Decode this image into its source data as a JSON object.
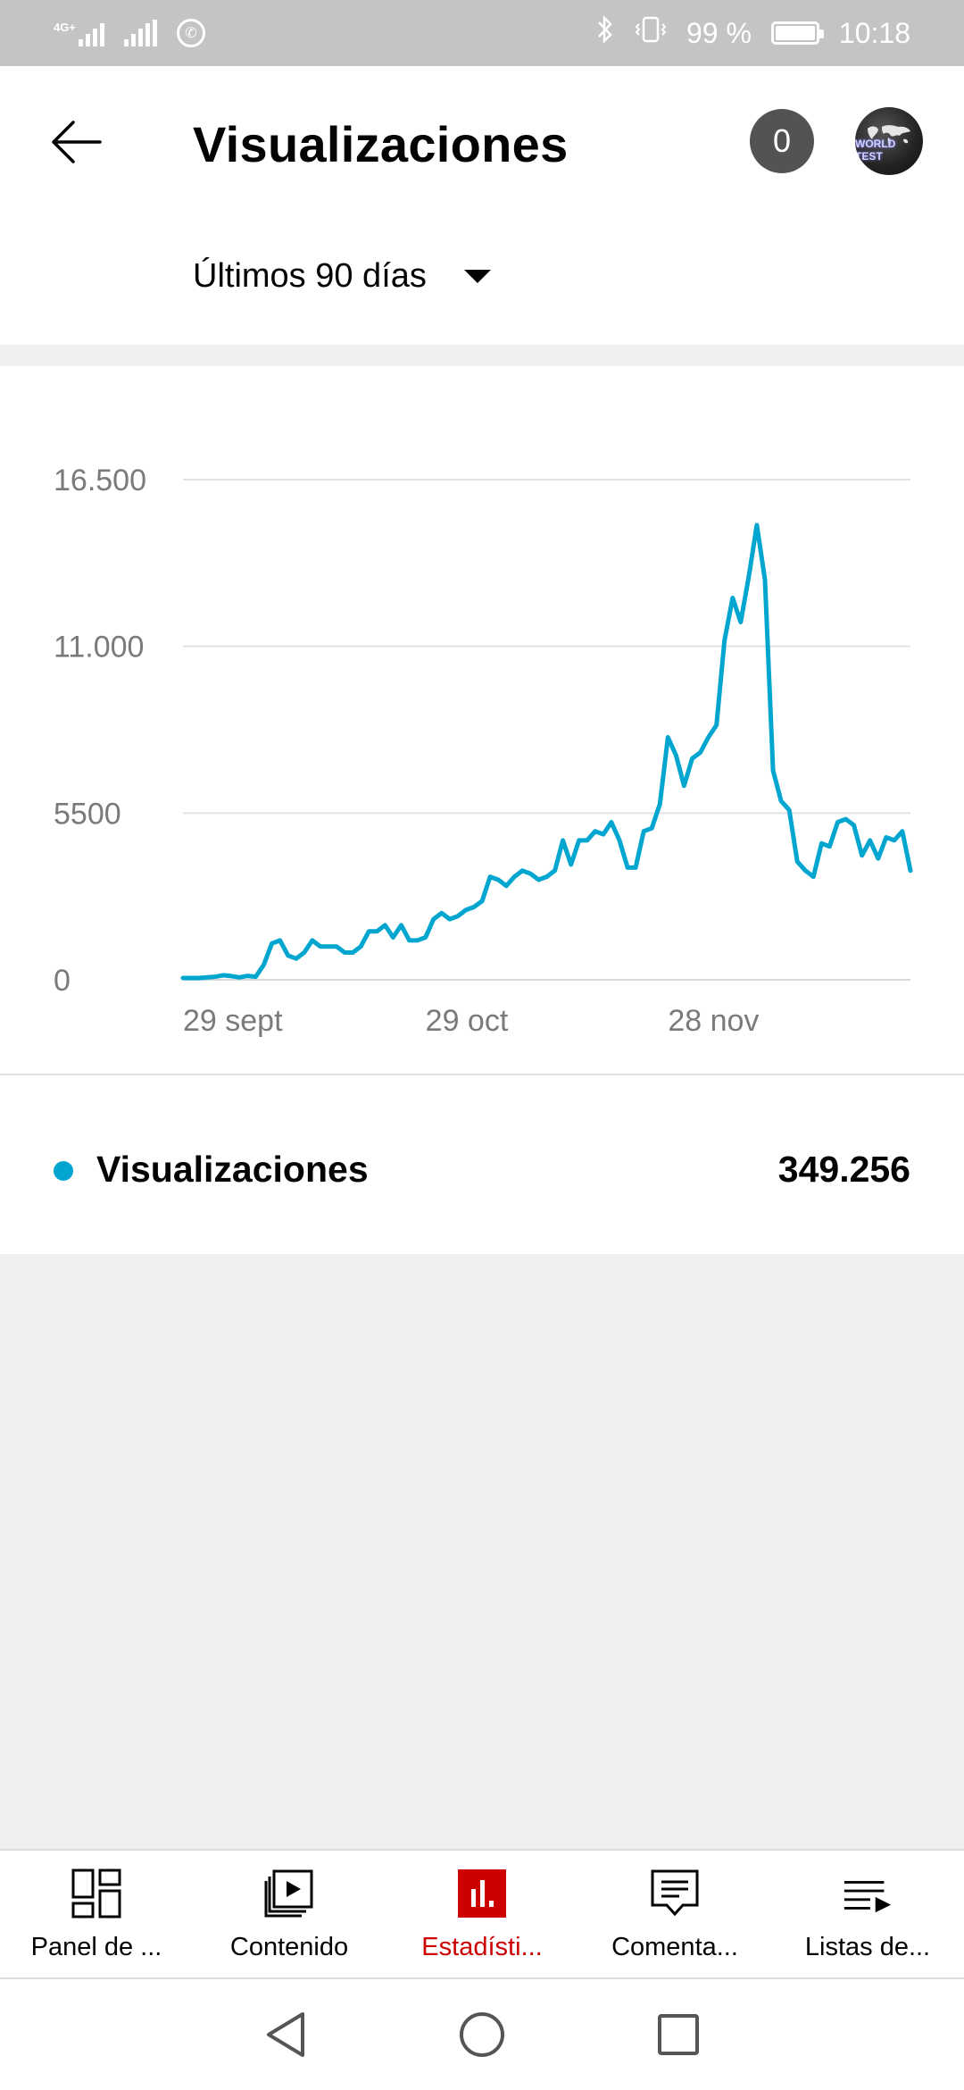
{
  "status_bar": {
    "network": "4G+",
    "battery_percent": "99 %",
    "time": "10:18"
  },
  "header": {
    "title": "Visualizaciones",
    "notification_count": "0",
    "avatar_text": "WORLD TEST",
    "period": "Últimos 90 días"
  },
  "chart_data": {
    "type": "line",
    "title": "",
    "xlabel": "",
    "ylabel": "",
    "ylim": [
      0,
      16500
    ],
    "y_ticks": [
      "16.500",
      "11.000",
      "5500",
      "0"
    ],
    "y_tick_values": [
      16500,
      11000,
      5500,
      0
    ],
    "x_tick_labels": [
      "29 sept",
      "29 oct",
      "28 nov"
    ],
    "x_tick_days": [
      0,
      30,
      60
    ],
    "x_range_days": [
      0,
      90
    ],
    "grid": true,
    "color": "#00a6cf",
    "series": [
      {
        "name": "Visualizaciones",
        "x": [
          0,
          1,
          2,
          3,
          4,
          5,
          6,
          7,
          8,
          9,
          10,
          11,
          12,
          13,
          14,
          15,
          16,
          17,
          18,
          19,
          20,
          21,
          22,
          23,
          24,
          25,
          26,
          27,
          28,
          29,
          30,
          31,
          32,
          33,
          34,
          35,
          36,
          37,
          38,
          39,
          40,
          41,
          42,
          43,
          44,
          45,
          46,
          47,
          48,
          49,
          50,
          51,
          52,
          53,
          54,
          55,
          56,
          57,
          58,
          59,
          60,
          61,
          62,
          63,
          64,
          65,
          66,
          67,
          68,
          69,
          70,
          71,
          72,
          73,
          74,
          75,
          76,
          77,
          78,
          79,
          80,
          81,
          82,
          83,
          84,
          85,
          86,
          87,
          88,
          89,
          90
        ],
        "values": [
          60,
          60,
          60,
          80,
          100,
          150,
          120,
          80,
          130,
          100,
          500,
          1200,
          1300,
          800,
          700,
          900,
          1300,
          1100,
          1100,
          1100,
          900,
          900,
          1100,
          1600,
          1600,
          1800,
          1400,
          1800,
          1300,
          1300,
          1400,
          2000,
          2200,
          2000,
          2100,
          2300,
          2400,
          2600,
          3400,
          3300,
          3100,
          3400,
          3600,
          3500,
          3300,
          3400,
          3600,
          4600,
          3800,
          4600,
          4600,
          4900,
          4800,
          5200,
          4600,
          3700,
          3700,
          4900,
          5000,
          5800,
          8000,
          7400,
          6400,
          7300,
          7500,
          8000,
          8400,
          11200,
          12600,
          11800,
          13300,
          15000,
          13200,
          6900,
          5900,
          5600,
          3900,
          3600,
          3400,
          4500,
          4400,
          5200,
          5300,
          5100,
          4100,
          4600,
          4000,
          4700,
          4600,
          4900,
          3600
        ]
      }
    ]
  },
  "legend": {
    "label": "Visualizaciones",
    "total": "349.256",
    "dot_color": "#00a6cf"
  },
  "bottom_nav": {
    "items": [
      {
        "label": "Panel de ...",
        "icon": "dashboard-icon"
      },
      {
        "label": "Contenido",
        "icon": "content-icon"
      },
      {
        "label": "Estadísti...",
        "icon": "analytics-icon",
        "active": true
      },
      {
        "label": "Comenta...",
        "icon": "comments-icon"
      },
      {
        "label": "Listas de...",
        "icon": "playlist-icon"
      }
    ]
  },
  "colors": {
    "accent": "#00a6cf",
    "active_tab": "#cc0000",
    "status_bar_bg": "#c4c4c4",
    "page_bg": "#efefef"
  }
}
